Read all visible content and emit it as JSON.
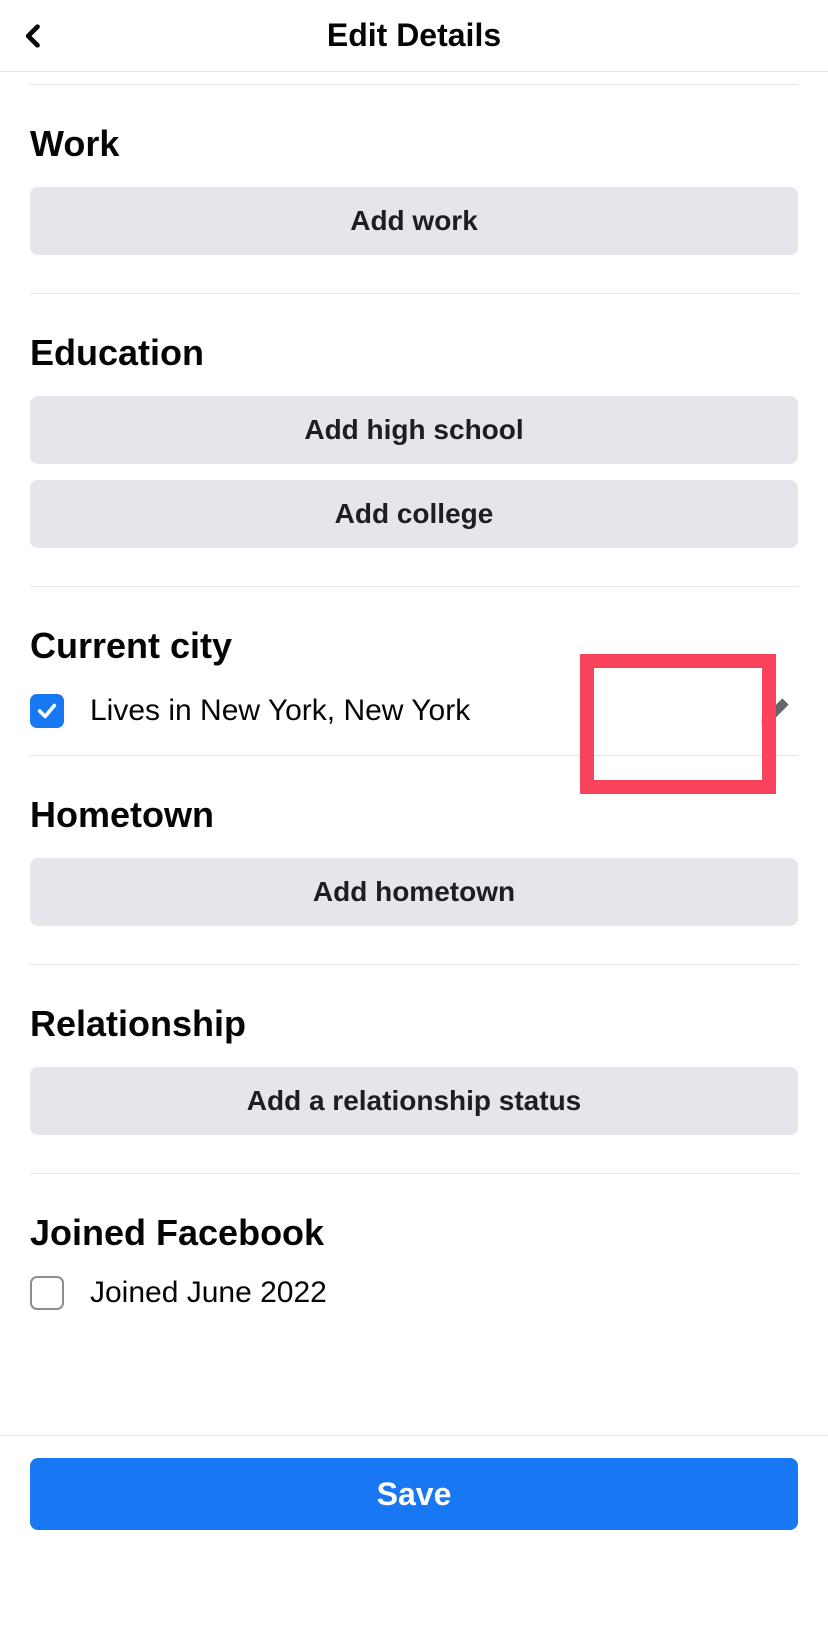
{
  "header": {
    "title": "Edit Details"
  },
  "sections": {
    "work": {
      "title": "Work",
      "addBtn": "Add work"
    },
    "education": {
      "title": "Education",
      "addHighSchool": "Add high school",
      "addCollege": "Add college"
    },
    "currentCity": {
      "title": "Current city",
      "itemLabel": "Lives in New York, New York",
      "checked": true
    },
    "hometown": {
      "title": "Hometown",
      "addBtn": "Add hometown"
    },
    "relationship": {
      "title": "Relationship",
      "addBtn": "Add a relationship status"
    },
    "joinedFacebook": {
      "title": "Joined Facebook",
      "itemLabel": "Joined June 2022",
      "checked": false
    }
  },
  "footer": {
    "saveBtn": "Save"
  }
}
